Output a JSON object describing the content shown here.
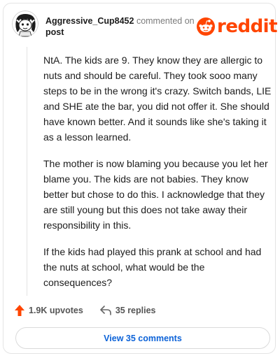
{
  "comment": {
    "username": "Aggressive_Cup8452",
    "action_text": "commented on",
    "post_link": "post",
    "paragraphs": [
      "NtA. The kids are 9. They know they are allergic to nuts and should be careful. They took sooo many steps to be in the wrong it's crazy. Switch bands, LIE and SHE ate the bar, you did not offer it. She should have known better. And it sounds like she's taking it as a lesson learned.",
      "The mother is now blaming you because you let her blame you. The kids are not babies. They know better but chose to do this. I acknowledge that they are still young but this does not take away their responsibility in this.",
      "If the kids had played this prank at school and had the nuts at school, what would be the consequences?"
    ],
    "upvotes": "1.9K upvotes",
    "replies": "35 replies",
    "view_comments": "View 35 comments"
  },
  "brand": {
    "wordmark": "reddit",
    "color": "#ff4500"
  },
  "icons": {
    "avatar": "snoo-avatar",
    "upvote": "upvote-arrow-icon",
    "reply": "reply-arrow-icon",
    "logo": "reddit-snoo-icon"
  },
  "colors": {
    "link": "#0d63d8",
    "upvote": "#ff4500",
    "muted": "#7c7c7c"
  }
}
